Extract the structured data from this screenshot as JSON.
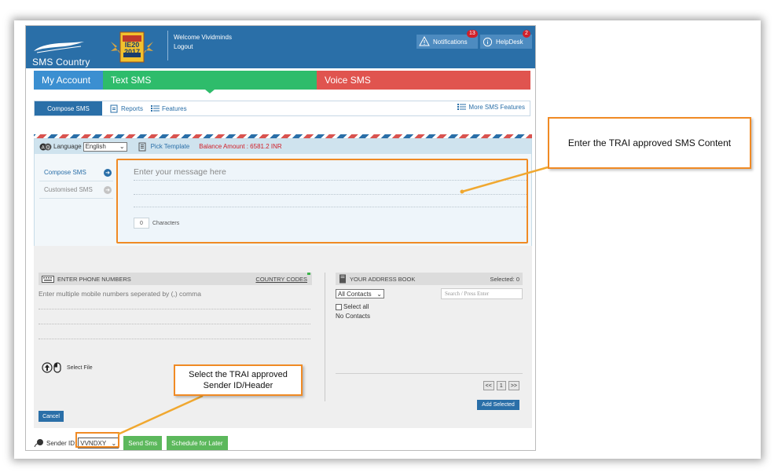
{
  "header": {
    "logo_text": "SMS Country",
    "award_text": "IE20 2017",
    "welcome": "Welcome Vividminds",
    "logout": "Logout",
    "notifications_label": "Notifications",
    "notifications_count": "13",
    "helpdesk_label": "HelpDesk",
    "helpdesk_count": "2"
  },
  "nav": {
    "my_account": "My Account",
    "text_sms": "Text SMS",
    "voice_sms": "Voice SMS"
  },
  "subnav": {
    "compose": "Compose SMS",
    "reports": "Reports",
    "features": "Features",
    "more": "More SMS Features"
  },
  "compose": {
    "language_label": "Language",
    "language_value": "English",
    "pick_template": "Pick Template",
    "balance": "Balance Amount : 6581.2 INR",
    "side_compose": "Compose SMS",
    "side_customised": "Customised SMS",
    "message_placeholder": "Enter your message here",
    "char_count": "0",
    "characters_label": "Characters"
  },
  "phones": {
    "header": "ENTER PHONE NUMBERS",
    "country_codes": "COUNTRY CODES",
    "hint": "Enter multiple mobile numbers seperated by (,) comma",
    "select_file": "Select File",
    "cancel": "Cancel"
  },
  "address_book": {
    "header": "YOUR ADDRESS BOOK",
    "selected": "Selected: 0",
    "contacts_filter": "All Contacts",
    "search_placeholder": "Search / Press Enter",
    "select_all": "Select all",
    "no_contacts": "No Contacts",
    "pager_prev": "<<",
    "pager_page": "1",
    "pager_next": ">>",
    "add_selected": "Add Selected"
  },
  "bottom": {
    "sender_label": "Sender ID:",
    "sender_value": "VVNDXY",
    "send_sms": "Send Sms",
    "schedule": "Schedule for Later"
  },
  "annotations": {
    "callout_content": "Enter the TRAI approved SMS Content",
    "callout_sender": "Select the TRAI approved Sender ID/Header"
  },
  "colors": {
    "brand_blue": "#2a6fa8",
    "text_sms_green": "#2ebc6b",
    "voice_sms_red": "#e0544f",
    "highlight_orange": "#f08a24"
  }
}
